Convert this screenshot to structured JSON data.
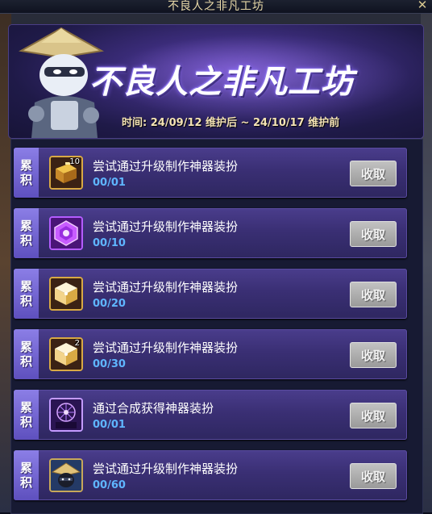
{
  "window": {
    "title": "不良人之非凡工坊",
    "close_label": "✕"
  },
  "banner": {
    "title": "不良人之非凡工坊",
    "time": "时间: 24/09/12 维护后 ~ 24/10/17 维护前"
  },
  "colors": {
    "progress": "#5fb6ff",
    "tag": "#7a6ad8",
    "button": "#a8a8a8"
  },
  "tasks": [
    {
      "tag": [
        "累",
        "积"
      ],
      "icon": "gold-crate-icon",
      "count": "10",
      "desc": "尝试通过升级制作神器装扮",
      "progress": "00/01",
      "button": "收取"
    },
    {
      "tag": [
        "累",
        "积"
      ],
      "icon": "purple-token-icon",
      "count": "",
      "desc": "尝试通过升级制作神器装扮",
      "progress": "00/10",
      "button": "收取"
    },
    {
      "tag": [
        "累",
        "积"
      ],
      "icon": "gold-cube-icon",
      "count": "",
      "desc": "尝试通过升级制作神器装扮",
      "progress": "00/20",
      "button": "收取"
    },
    {
      "tag": [
        "累",
        "积"
      ],
      "icon": "gold-cube-icon",
      "count": "2",
      "desc": "尝试通过升级制作神器装扮",
      "progress": "00/30",
      "button": "收取"
    },
    {
      "tag": [
        "累",
        "积"
      ],
      "icon": "artifact-icon",
      "count": "",
      "desc": "通过合成获得神器装扮",
      "progress": "00/01",
      "button": "收取"
    },
    {
      "tag": [
        "累",
        "积"
      ],
      "icon": "ninja-avatar-icon",
      "count": "",
      "desc": "尝试通过升级制作神器装扮",
      "progress": "00/60",
      "button": "收取"
    }
  ]
}
